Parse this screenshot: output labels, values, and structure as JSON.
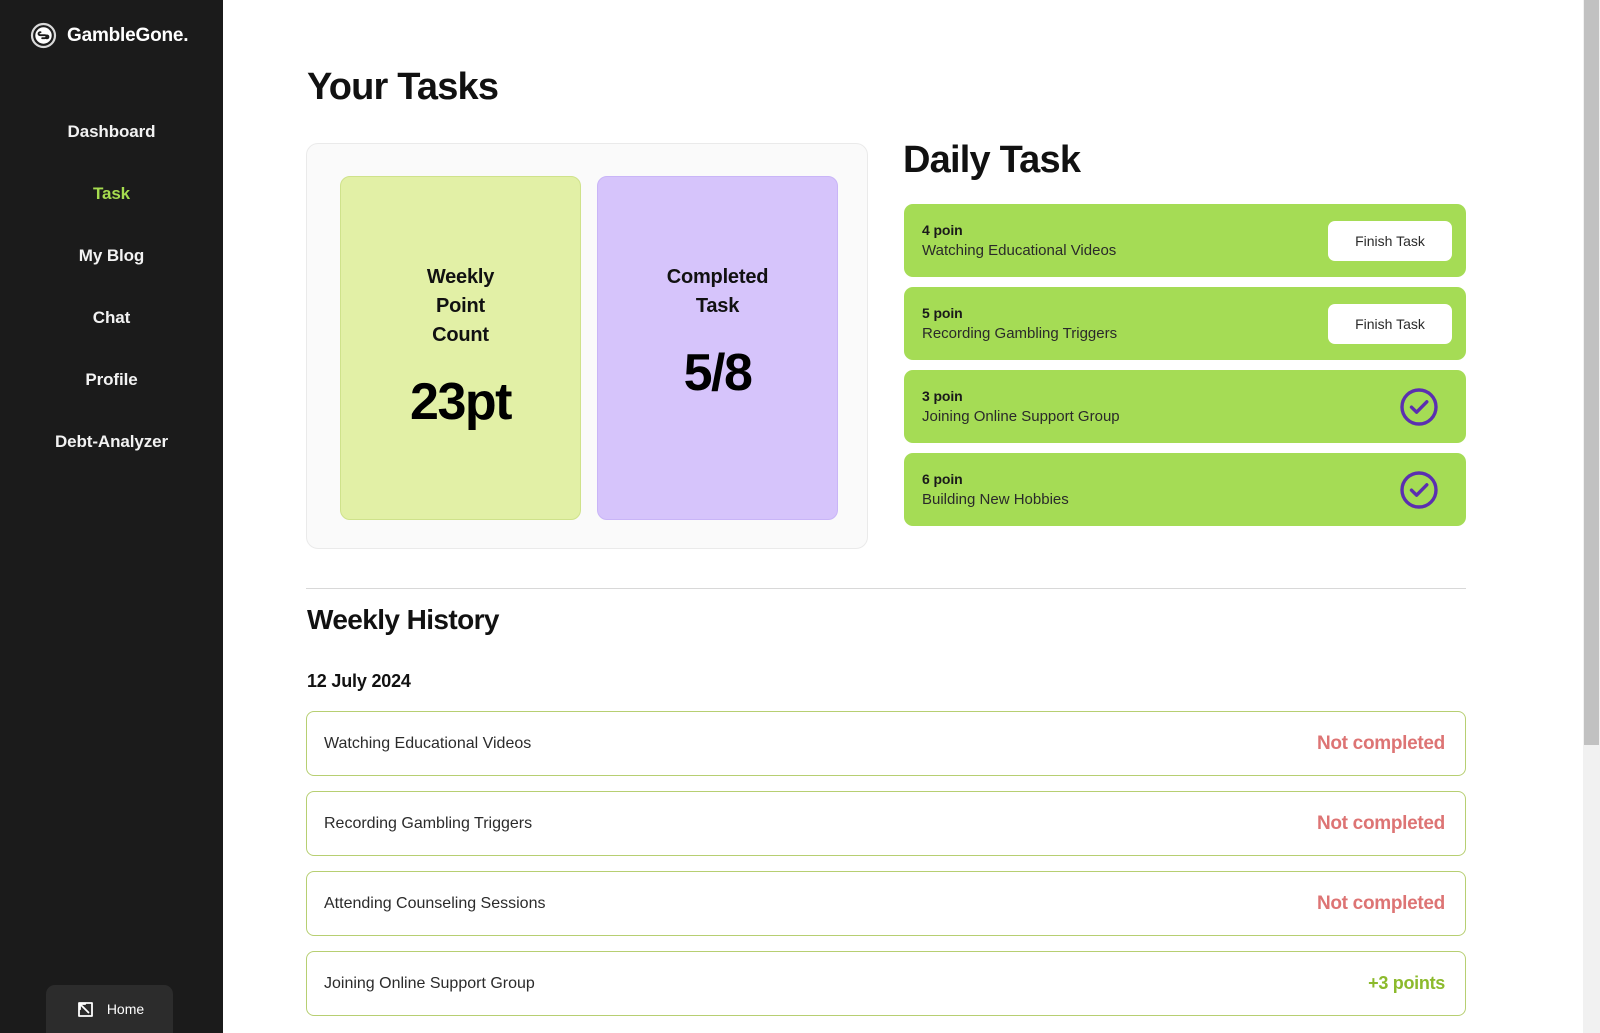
{
  "sidebar": {
    "brand": {
      "name": "GambleGone.",
      "logo_icon": "chain-link-circle-icon"
    },
    "items": [
      {
        "label": "Dashboard",
        "active": false
      },
      {
        "label": "Task",
        "active": true
      },
      {
        "label": "My Blog",
        "active": false
      },
      {
        "label": "Chat",
        "active": false
      },
      {
        "label": "Profile",
        "active": false
      },
      {
        "label": "Debt-Analyzer",
        "active": false
      }
    ],
    "home_button": {
      "label": "Home",
      "icon": "arrow-into-box-icon"
    },
    "active_color": "#a6dc4f",
    "background": "#1b1b1b"
  },
  "main": {
    "page_title": "Your Tasks",
    "stats": {
      "weekly": {
        "label": "Weekly\nPoint\nCount",
        "label_lines": [
          "Weekly",
          "Point",
          "Count"
        ],
        "value": "23pt",
        "color": "#e2f0a6"
      },
      "completed": {
        "label_lines": [
          "Completed",
          "Task"
        ],
        "value": "5/8",
        "color": "#d6c4fb"
      }
    },
    "daily_task": {
      "heading": "Daily Task",
      "card_color": "#a5dc55",
      "items": [
        {
          "points": "4 poin",
          "name": "Watching Educational Videos",
          "action": "Finish Task",
          "state": "pending"
        },
        {
          "points": "5 poin",
          "name": "Recording Gambling Triggers",
          "action": "Finish Task",
          "state": "pending"
        },
        {
          "points": "3 poin",
          "name": "Joining Online Support Group",
          "action": "check-circle-icon",
          "state": "done"
        },
        {
          "points": "6 poin",
          "name": "Building New Hobbies",
          "action": "check-circle-icon",
          "state": "done"
        }
      ]
    },
    "weekly_history": {
      "heading": "Weekly History",
      "date": "12 July 2024",
      "rows": [
        {
          "name": "Watching Educational Videos",
          "status": "Not completed",
          "status_kind": "not-completed"
        },
        {
          "name": "Recording Gambling Triggers",
          "status": "Not completed",
          "status_kind": "not-completed"
        },
        {
          "name": "Attending Counseling Sessions",
          "status": "Not completed",
          "status_kind": "not-completed"
        },
        {
          "name": "Joining Online Support Group",
          "status": "+3 points",
          "status_kind": "points"
        }
      ],
      "status_colors": {
        "not_completed": "#dd7474",
        "points": "#8cba2c"
      }
    }
  }
}
